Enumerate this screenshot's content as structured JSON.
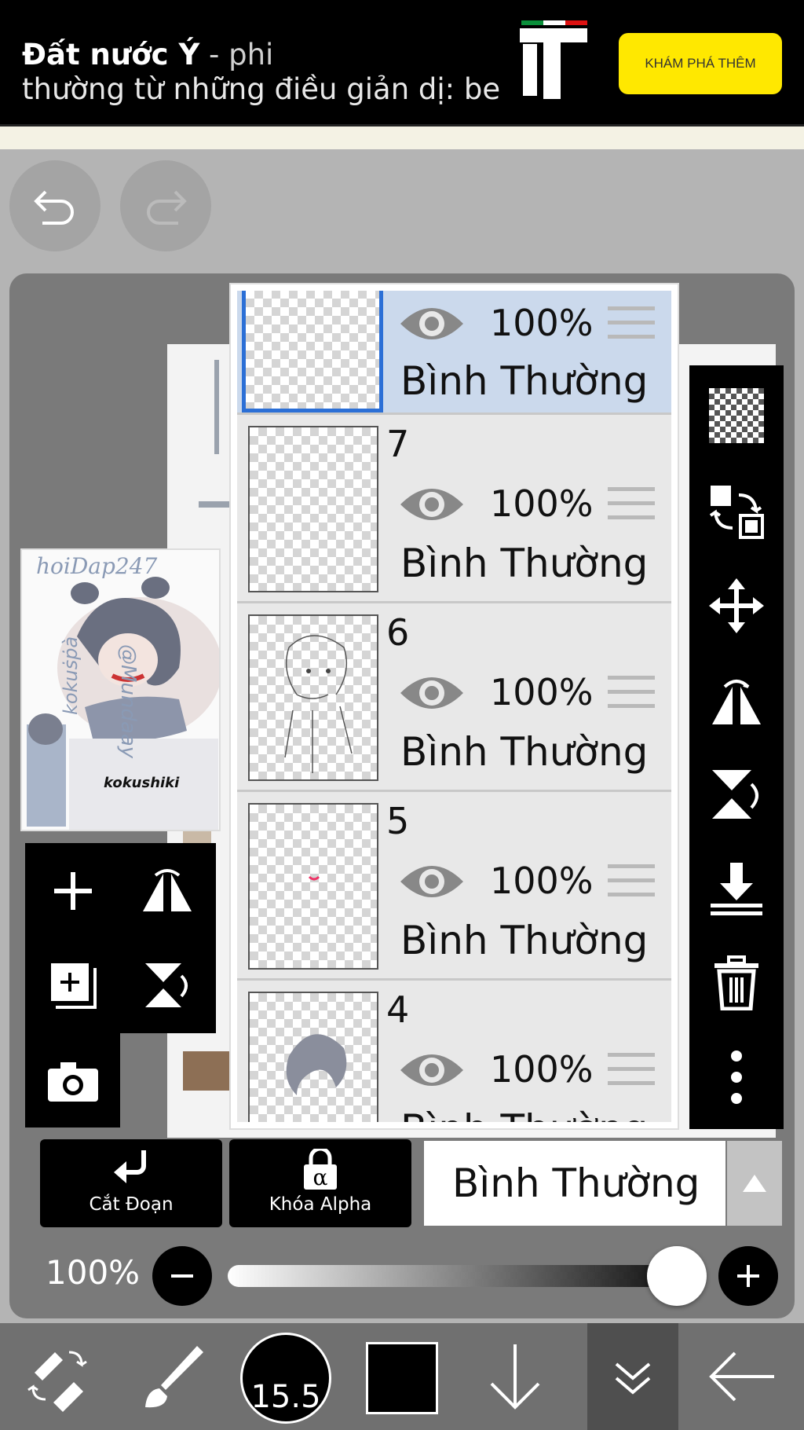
{
  "ad": {
    "title_bold": "Đất nước Ý",
    "title_rest": " - phi",
    "line2": "thường từ những điều giản dị: be",
    "cta": "KHÁM PHÁ THÊM"
  },
  "thumbnail": {
    "watermark_top": "hoiDap247",
    "watermark_side": "@Mundaay",
    "watermark_left": "kokuṡṗà",
    "signature": "kokushiki"
  },
  "layers": [
    {
      "num": "",
      "opacity": "100%",
      "blend": "Bình Thường",
      "selected": true
    },
    {
      "num": "7",
      "opacity": "100%",
      "blend": "Bình Thường"
    },
    {
      "num": "6",
      "opacity": "100%",
      "blend": "Bình Thường"
    },
    {
      "num": "5",
      "opacity": "100%",
      "blend": "Bình Thường"
    },
    {
      "num": "4",
      "opacity": "100%",
      "blend": "Bình Thường"
    }
  ],
  "controls": {
    "clip_label": "Cắt Đoạn",
    "alpha_lock_label": "Khóa Alpha",
    "alpha_symbol": "α",
    "blend_mode": "Bình Thường",
    "opacity_text": "100%",
    "opacity_value": 1.0
  },
  "toolbar": {
    "brush_size": "15.5",
    "color": "#000000"
  },
  "icons": {
    "undo": "undo-icon",
    "redo": "redo-icon",
    "add_layer": "plus-icon",
    "flip_h": "flip-horizontal-icon",
    "add_copy": "add-copy-icon",
    "flip_v": "flip-vertical-icon",
    "camera": "camera-icon",
    "checker": "transparency-icon",
    "swap": "swap-icon",
    "move": "move-icon",
    "merge_down": "merge-down-icon",
    "delete": "trash-icon",
    "more": "more-vertical-icon"
  }
}
